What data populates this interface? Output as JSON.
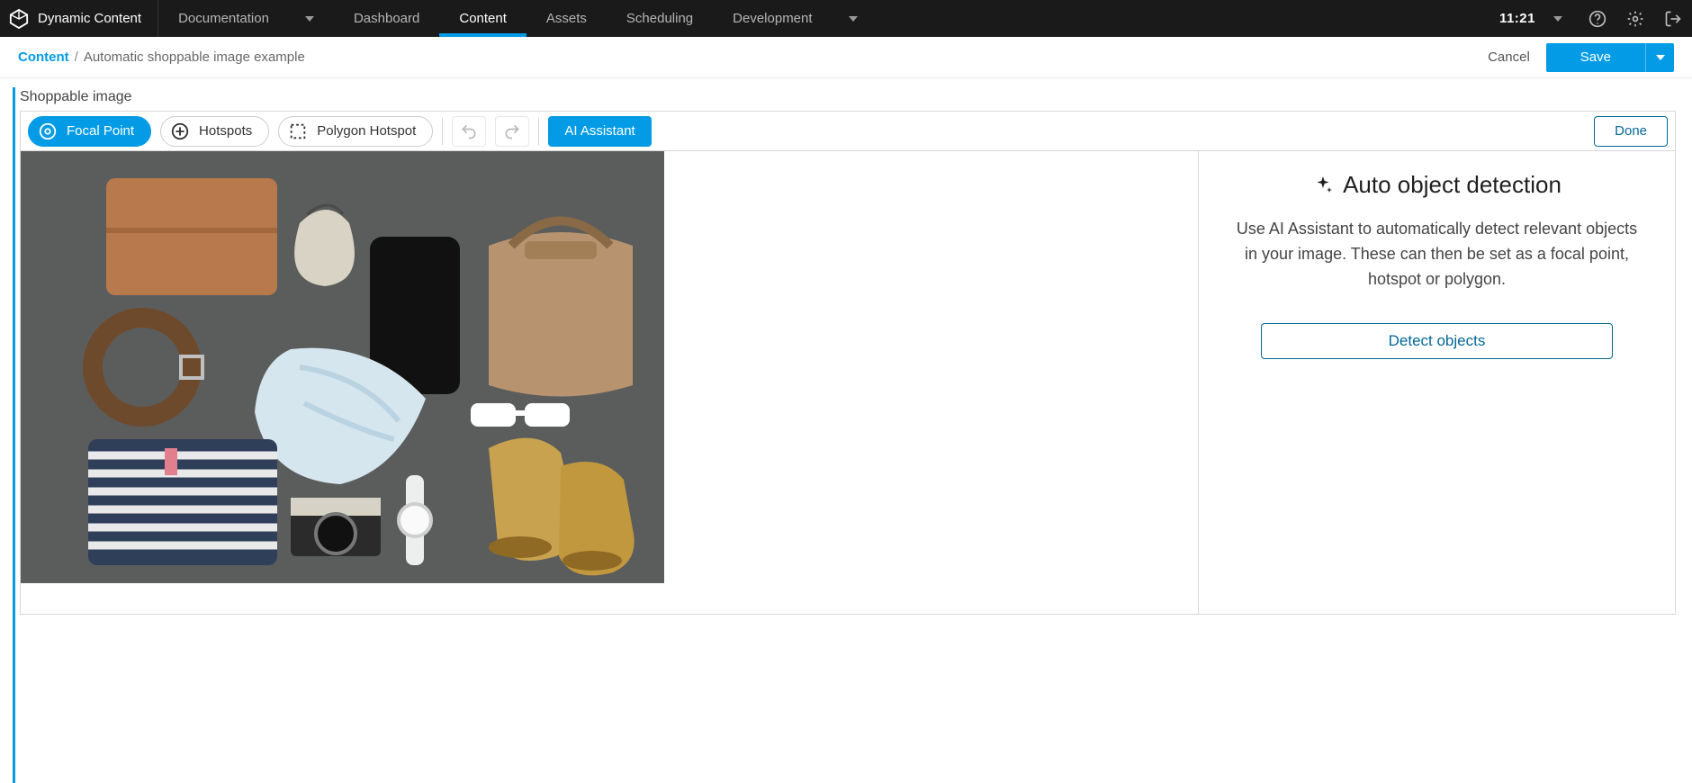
{
  "header": {
    "brand": "Dynamic Content",
    "nav": {
      "documentation": "Documentation",
      "dashboard": "Dashboard",
      "content": "Content",
      "assets": "Assets",
      "scheduling": "Scheduling",
      "development": "Development"
    },
    "time": "11:21"
  },
  "subheader": {
    "crumb_root": "Content",
    "crumb_sep": "/",
    "crumb_current": "Automatic shoppable image example",
    "cancel": "Cancel",
    "save": "Save"
  },
  "section": {
    "label": "Shoppable image"
  },
  "toolbar": {
    "focal_point": "Focal Point",
    "hotspots": "Hotspots",
    "polygon_hotspot": "Polygon Hotspot",
    "ai_assistant": "AI Assistant",
    "done": "Done"
  },
  "ai_panel": {
    "title": "Auto object detection",
    "description": "Use AI Assistant to automatically detect relevant objects in your image. These can then be set as a focal point, hotspot or polygon.",
    "detect_button": "Detect objects"
  },
  "colors": {
    "accent": "#039be5",
    "accent_dark": "#036796"
  }
}
